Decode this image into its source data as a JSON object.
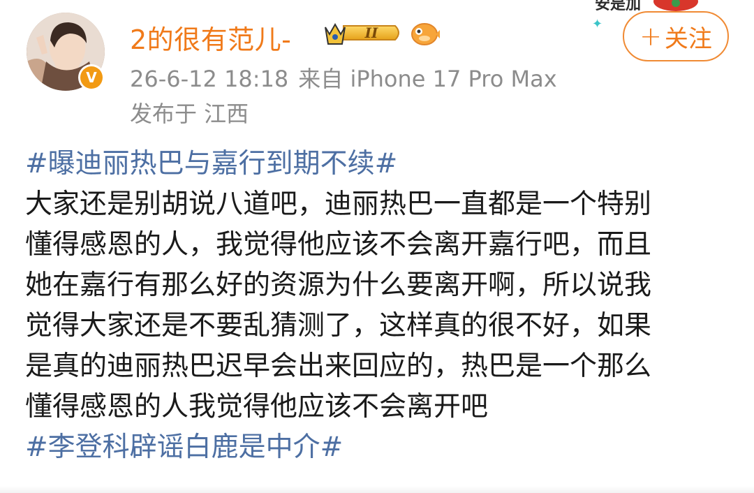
{
  "post": {
    "author": {
      "name": "2的很有范儿-",
      "badge_level": "II",
      "verified_mark": "V"
    },
    "timestamp": "26-6-12 18:18",
    "source": "来自 iPhone 17 Pro Max",
    "location": "发布于 江西",
    "follow_label": "关注",
    "follow_plus": "+",
    "hashtag_top": "#曝迪丽热巴与嘉行到期不续#",
    "body_lines": [
      "大家还是别胡说八道吧，迪丽热巴一直都是一个特别",
      "懂得感恩的人，我觉得他应该不会离开嘉行吧，而且",
      "她在嘉行有那么好的资源为什么要离开啊，所以说我",
      "觉得大家还是不要乱猜测了，这样真的很不好，如果",
      "是真的迪丽热巴迟早会出来回应的，热巴是一个那么",
      "懂得感恩的人我觉得他应该不会离开吧"
    ],
    "hashtag_bottom": "#李登科辟谣白鹿是中介#"
  },
  "decoration": {
    "partial_text": "安是加"
  },
  "colors": {
    "username": "#f07a1a",
    "hashtag": "#4d6fa3",
    "meta": "#8c8c8c",
    "follow_border": "#f08a33"
  },
  "icons": [
    "avatar",
    "verified-badge-icon",
    "crown-badge-icon",
    "pufferfish-icon",
    "plus-icon",
    "star-icon"
  ]
}
